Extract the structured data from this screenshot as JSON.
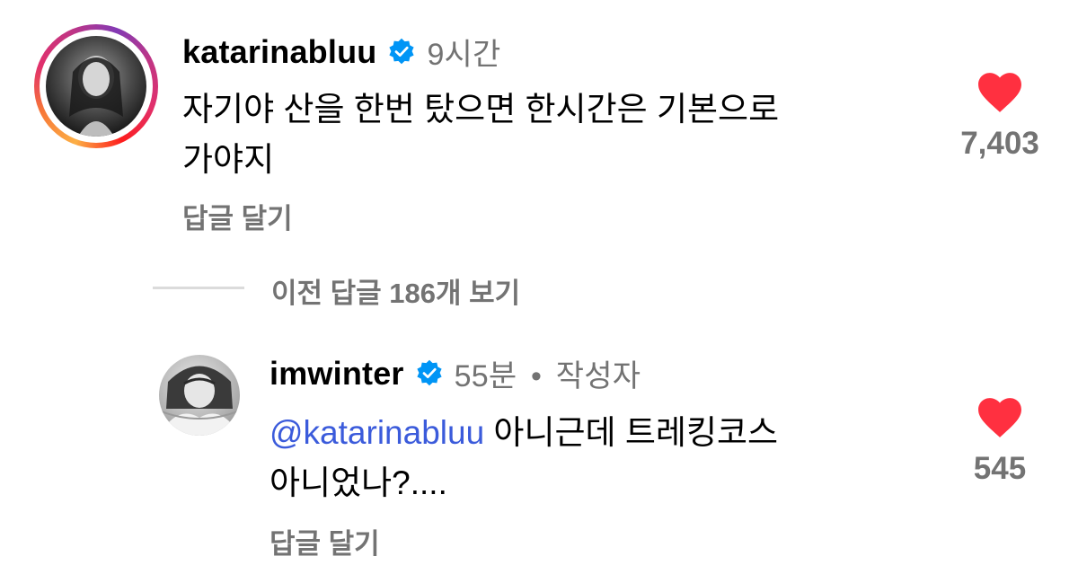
{
  "comments": [
    {
      "username": "katarinabluu",
      "time": "9시간",
      "text_line1": "자기야 산을 한번 탔으면 한시간은 기본으로",
      "text_line2": "가야지",
      "reply_label": "답글 달기",
      "likes": "7,403"
    },
    {
      "username": "imwinter",
      "time": "55분",
      "separator": "•",
      "author_tag": "작성자",
      "mention": "@katarinabluu",
      "text_line1": " 아니근데 트레킹코스",
      "text_line2": "아니었나?....",
      "reply_label": "답글 달기",
      "likes": "545"
    }
  ],
  "view_previous_replies": "이전 답글 186개 보기",
  "colors": {
    "verified": "#0095f6",
    "heart": "#ff3040",
    "secondary_text": "#737373",
    "mention": "#3b5bdb"
  },
  "icons": [
    "verified-badge-icon",
    "heart-icon"
  ]
}
